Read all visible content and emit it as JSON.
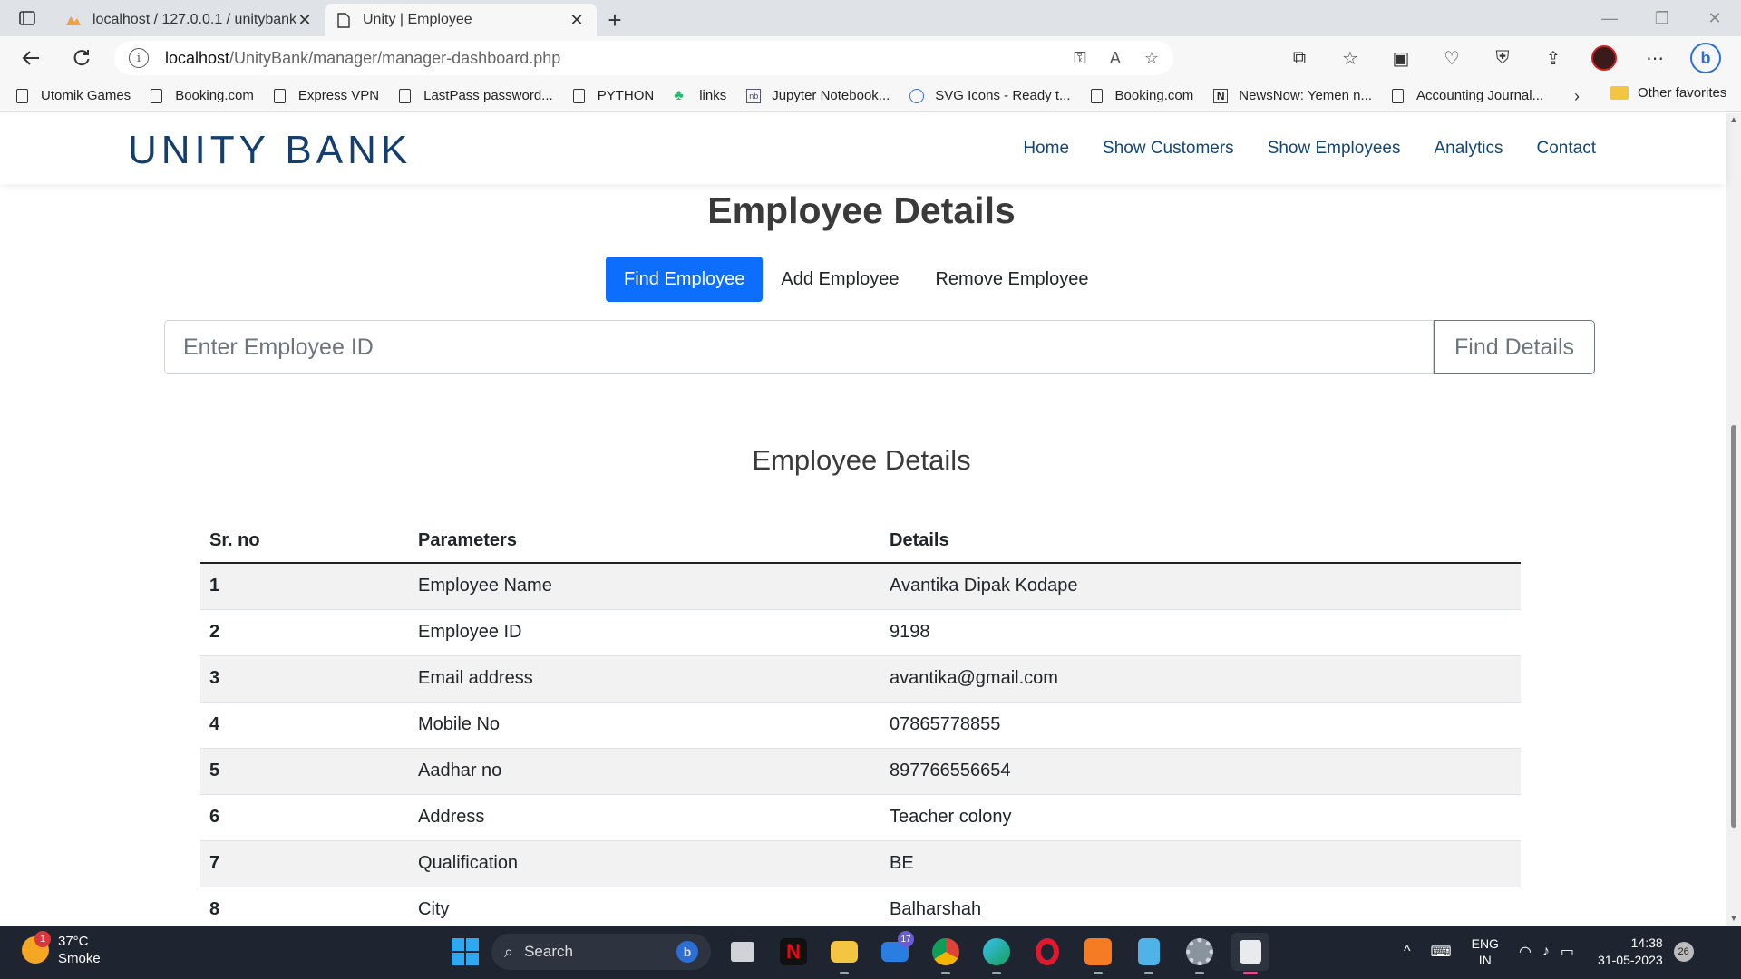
{
  "browser": {
    "tabs": [
      {
        "title": "localhost / 127.0.0.1 / unitybank",
        "active": false
      },
      {
        "title": "Unity | Employee",
        "active": true
      }
    ],
    "url": {
      "host": "localhost",
      "path": "/UnityBank/manager/manager-dashboard.php"
    },
    "bookmarks": [
      {
        "label": "Utomik Games",
        "icon": "doc-icon"
      },
      {
        "label": "Booking.com",
        "icon": "doc-icon"
      },
      {
        "label": "Express VPN",
        "icon": "doc-icon"
      },
      {
        "label": "LastPass password...",
        "icon": "doc-icon"
      },
      {
        "label": "PYTHON",
        "icon": "doc-icon"
      },
      {
        "label": "links",
        "icon": "tree-icon"
      },
      {
        "label": "Jupyter Notebook...",
        "icon": "nb-icon"
      },
      {
        "label": "SVG Icons - Ready t...",
        "icon": "globe-icon"
      },
      {
        "label": "Booking.com",
        "icon": "doc-icon"
      },
      {
        "label": "NewsNow: Yemen n...",
        "icon": "n-icon"
      },
      {
        "label": "Accounting Journal...",
        "icon": "doc-icon"
      }
    ],
    "other_favorites": "Other favorites"
  },
  "site": {
    "brand": "UNITY BANK",
    "nav": [
      "Home",
      "Show Customers",
      "Show Employees",
      "Analytics",
      "Contact"
    ]
  },
  "main": {
    "title": "Employee Details",
    "tabs": [
      "Find Employee",
      "Add Employee",
      "Remove Employee"
    ],
    "search": {
      "placeholder": "Enter Employee ID",
      "button": "Find Details"
    },
    "table_title": "Employee Details",
    "columns": [
      "Sr. no",
      "Parameters",
      "Details"
    ],
    "rows": [
      [
        "1",
        "Employee Name",
        "Avantika Dipak Kodape"
      ],
      [
        "2",
        "Employee ID",
        "9198"
      ],
      [
        "3",
        "Email address",
        "avantika@gmail.com"
      ],
      [
        "4",
        "Mobile No",
        "07865778855"
      ],
      [
        "5",
        "Aadhar no",
        "897766556654"
      ],
      [
        "6",
        "Address",
        "Teacher colony"
      ],
      [
        "7",
        "Qualification",
        "BE"
      ],
      [
        "8",
        "City",
        "Balharshah"
      ]
    ]
  },
  "taskbar": {
    "weather": {
      "temp": "37°C",
      "desc": "Smoke",
      "badge": "1"
    },
    "search": "Search",
    "mail_count": "17",
    "lang": {
      "line1": "ENG",
      "line2": "IN"
    },
    "time": "14:38",
    "date": "31-05-2023",
    "notifications": "26"
  },
  "colors": {
    "primary": "#0d6efd",
    "brand": "#143e6e",
    "nav": "#124776"
  }
}
